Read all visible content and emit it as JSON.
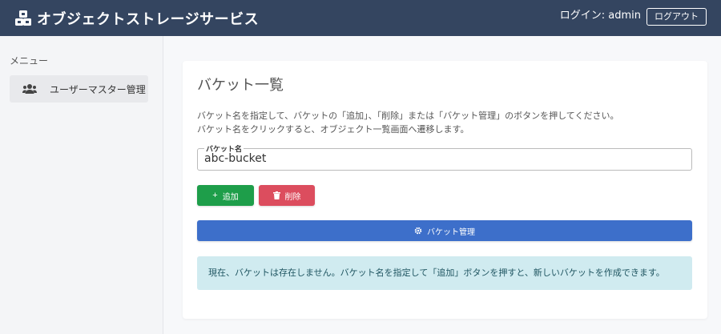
{
  "header": {
    "app_title": "オブジェクトストレージサービス",
    "login_text": "ログイン: admin",
    "logout_label": "ログアウト",
    "brand_icon": "cubes-icon"
  },
  "sidebar": {
    "menu_title": "メニュー",
    "items": [
      {
        "label": "ユーザーマスター管理",
        "icon": "users-icon"
      }
    ]
  },
  "main": {
    "card_title": "バケット一覧",
    "description_lines": [
      "バケット名を指定して、バケットの「追加」、「削除」または「バケット管理」のボタンを押してください。",
      "バケット名をクリックすると、オブジェクト一覧画面へ遷移します。"
    ],
    "bucket_field": {
      "label": "バケット名",
      "value": "abc-bucket"
    },
    "buttons": {
      "add_label": "追加",
      "delete_label": "削除",
      "manage_label": "バケット管理"
    },
    "alert_text": "現在、バケットは存在しません。バケット名を指定して「追加」ボタンを押すと、新しいバケットを作成できます。"
  },
  "colors": {
    "header_bg": "#344560",
    "add_button": "#1e9e4a",
    "delete_button": "#dc4d5e",
    "manage_button": "#3d6fca",
    "alert_bg": "#d0ebf0"
  }
}
